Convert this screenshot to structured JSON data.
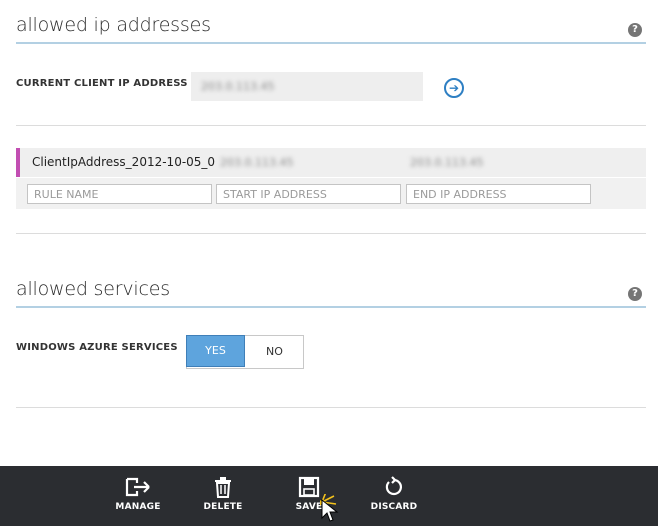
{
  "ip_section": {
    "title": "allowed ip addresses",
    "help_icon": "?",
    "current_ip_label": "CURRENT CLIENT IP ADDRESS",
    "current_ip_value": "203.0.113.45",
    "add_arrow": "➔",
    "rules": [
      {
        "name": "ClientIpAddress_2012-10-05_0",
        "start_ip": "203.0.113.45",
        "end_ip": "203.0.113.45"
      }
    ],
    "new_rule": {
      "name_placeholder": "RULE NAME",
      "start_placeholder": "START IP ADDRESS",
      "end_placeholder": "END IP ADDRESS"
    }
  },
  "services_section": {
    "title": "allowed services",
    "help_icon": "?",
    "azure_label": "WINDOWS AZURE SERVICES",
    "yes_label": "YES",
    "no_label": "NO",
    "selected": "YES"
  },
  "commandbar": {
    "manage": "MANAGE",
    "delete": "DELETE",
    "save": "SAVE",
    "discard": "DISCARD"
  },
  "colors": {
    "accent_blue": "#5ea4dd",
    "rule_accent": "#c24eb2",
    "commandbar_bg": "#2b2d31"
  },
  "icons": [
    "help-icon",
    "arrow-circle-icon",
    "manage-icon",
    "delete-icon",
    "save-icon",
    "discard-icon",
    "mouse-cursor-icon"
  ]
}
